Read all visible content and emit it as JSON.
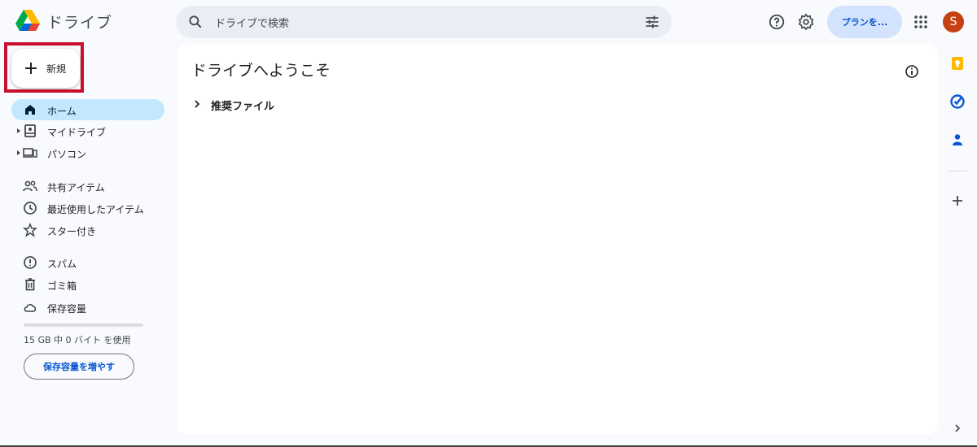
{
  "header": {
    "app_title": "ドライブ",
    "search_placeholder": "ドライブで検索",
    "plan_button": "プランを...",
    "avatar_initial": "S",
    "brand_colors": [
      "#0066da",
      "#00ac47",
      "#ea4335",
      "#ffba00"
    ],
    "icons": [
      "search-icon",
      "tune-icon",
      "help-icon",
      "settings-icon",
      "apps-icon"
    ]
  },
  "new_button": {
    "label": "新規"
  },
  "sidebar": {
    "items": [
      {
        "label": "ホーム",
        "icon": "home-icon",
        "active": true
      },
      {
        "label": "マイドライブ",
        "icon": "my-drive-icon",
        "expandable": true
      },
      {
        "label": "パソコン",
        "icon": "computers-icon",
        "expandable": true
      },
      {
        "label": "共有アイテム",
        "icon": "shared-icon"
      },
      {
        "label": "最近使用したアイテム",
        "icon": "recent-icon"
      },
      {
        "label": "スター付き",
        "icon": "star-icon"
      },
      {
        "label": "スパム",
        "icon": "spam-icon"
      },
      {
        "label": "ゴミ箱",
        "icon": "trash-icon"
      },
      {
        "label": "保存容量",
        "icon": "cloud-icon"
      }
    ],
    "storage_used_fraction": 0,
    "storage_text": "15 GB 中 0 バイト を使用",
    "storage_button": "保存容量を増やす"
  },
  "main": {
    "title": "ドライブへようこそ",
    "section_label": "推奨ファイル"
  },
  "side_panel": {
    "icons": [
      "keep-icon",
      "tasks-icon",
      "contacts-icon",
      "add-icon",
      "expand-icon"
    ]
  }
}
